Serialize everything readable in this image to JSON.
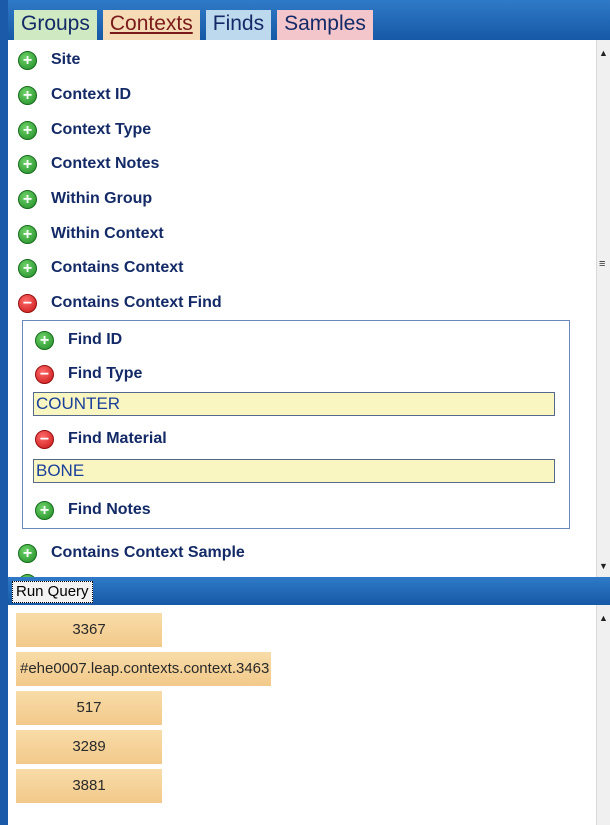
{
  "tabs": [
    {
      "label": "Groups"
    },
    {
      "label": "Contexts"
    },
    {
      "label": "Finds"
    },
    {
      "label": "Samples"
    }
  ],
  "builder": {
    "fields": [
      {
        "label": "Site",
        "state": "plus"
      },
      {
        "label": "Context ID",
        "state": "plus"
      },
      {
        "label": "Context Type",
        "state": "plus"
      },
      {
        "label": "Context Notes",
        "state": "plus"
      },
      {
        "label": "Within Group",
        "state": "plus"
      },
      {
        "label": "Within Context",
        "state": "plus"
      },
      {
        "label": "Contains Context",
        "state": "plus"
      },
      {
        "label": "Contains Context Find",
        "state": "minus"
      }
    ],
    "find_fields": [
      {
        "label": "Find ID",
        "state": "plus"
      },
      {
        "label": "Find Type",
        "state": "minus",
        "value": "COUNTER"
      },
      {
        "label": "Find Material",
        "state": "minus",
        "value": "BONE"
      },
      {
        "label": "Find Notes",
        "state": "plus"
      }
    ],
    "after_fields": [
      {
        "label": "Contains Context Sample",
        "state": "plus"
      }
    ]
  },
  "query": {
    "run_label": "Run Query"
  },
  "results": [
    "3367",
    "#ehe0007.leap.contexts.context.3463",
    "517",
    "3289",
    "3881"
  ],
  "colors": {
    "frame": "#1a5aa8",
    "result_bg": "#f4cf94",
    "field_bg": "#faf6c2",
    "label": "#132a66"
  }
}
